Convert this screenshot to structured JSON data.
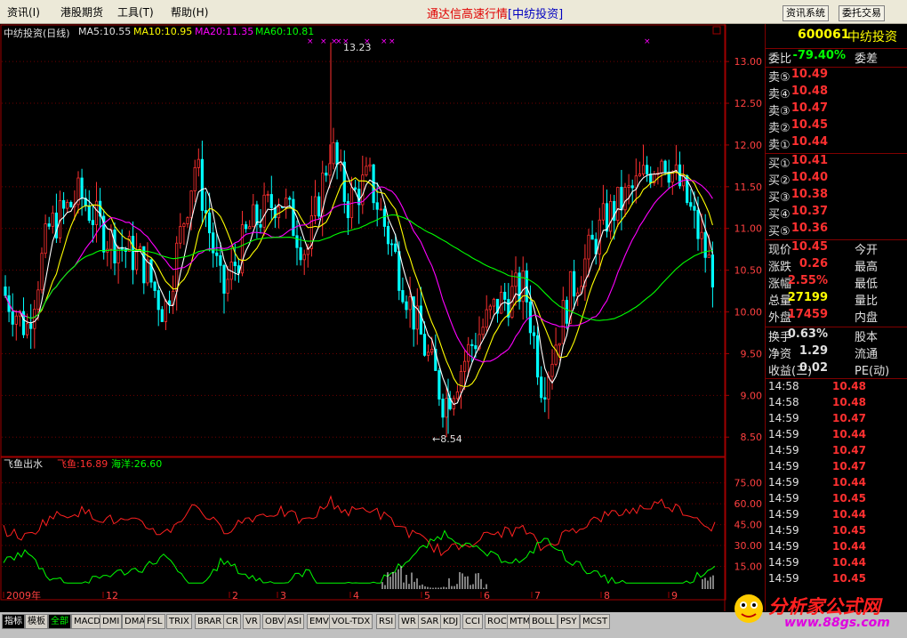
{
  "menubar": {
    "items": [
      "资讯(I)",
      "港股期货",
      "工具(T)",
      "帮助(H)"
    ],
    "title": "通达信高速行情",
    "stock_tag": "[中纺投资]",
    "btn_news": "资讯系统",
    "btn_trade": "委托交易"
  },
  "main_chart": {
    "stock_label": "中纺投资(日线)",
    "ma5": "MA5:10.55",
    "ma10": "MA10:10.95",
    "ma20": "MA20:11.35",
    "ma60": "MA60:10.81",
    "high_label": "13.23",
    "low_label": "←8.54",
    "colors": {
      "ma5": "#ffffff",
      "ma10": "#ffff00",
      "ma20": "#ff00ff",
      "ma60": "#00ff00",
      "up": "#ff3030",
      "down": "#00ffff"
    }
  },
  "indicator": {
    "name": "飞鱼出水",
    "line1": "飞鱼:16.89",
    "line2": "海洋:26.60"
  },
  "chart_data": [
    {
      "type": "candlestick",
      "title": "中纺投资(日线)",
      "ylim": [
        8.3,
        13.3
      ],
      "y_ticks": [
        "13.00",
        "12.50",
        "12.00",
        "11.50",
        "11.00",
        "10.50",
        "10.00",
        "9.50",
        "9.00",
        "8.50"
      ],
      "x_ticks": [
        "2009年",
        "12",
        "2",
        "3",
        "4",
        "5",
        "6",
        "7",
        "8",
        "9"
      ],
      "high": 13.23,
      "low": 8.54,
      "series": [
        {
          "name": "MA5",
          "last": 10.55
        },
        {
          "name": "MA10",
          "last": 10.95
        },
        {
          "name": "MA20",
          "last": 11.35
        },
        {
          "name": "MA60",
          "last": 10.81
        }
      ]
    },
    {
      "type": "line",
      "title": "飞鱼出水",
      "ylim": [
        0,
        85
      ],
      "y_ticks": [
        "75.00",
        "60.00",
        "45.00",
        "30.00",
        "15.00"
      ],
      "series": [
        {
          "name": "飞鱼",
          "last": 16.89
        },
        {
          "name": "海洋",
          "last": 26.6
        }
      ]
    }
  ],
  "panel": {
    "code": "600061",
    "name": "中纺投资",
    "wb_label": "委比",
    "wb_value": "-79.40%",
    "wc_label": "委差",
    "asks": [
      {
        "label": "卖⑤",
        "price": "10.49"
      },
      {
        "label": "卖④",
        "price": "10.48"
      },
      {
        "label": "卖③",
        "price": "10.47"
      },
      {
        "label": "卖②",
        "price": "10.45"
      },
      {
        "label": "卖①",
        "price": "10.44"
      }
    ],
    "bids": [
      {
        "label": "买①",
        "price": "10.41"
      },
      {
        "label": "买②",
        "price": "10.40"
      },
      {
        "label": "买③",
        "price": "10.38"
      },
      {
        "label": "买④",
        "price": "10.37"
      },
      {
        "label": "买⑤",
        "price": "10.36"
      }
    ],
    "stats": [
      {
        "label": "现价",
        "value": "10.45",
        "label2": "今开",
        "color": "#ff3030"
      },
      {
        "label": "涨跌",
        "value": "0.26",
        "label2": "最高",
        "color": "#ff3030"
      },
      {
        "label": "涨幅",
        "value": "2.55%",
        "label2": "最低",
        "color": "#ff3030"
      },
      {
        "label": "总量",
        "value": "27199",
        "label2": "量比",
        "color": "#ffff00"
      },
      {
        "label": "外盘",
        "value": "17459",
        "label2": "内盘",
        "color": "#ff3030"
      }
    ],
    "stats2": [
      {
        "label": "换手",
        "value": "0.63%",
        "label2": "股本",
        "color": "#e0e0e0"
      },
      {
        "label": "净资",
        "value": "1.29",
        "label2": "流通",
        "color": "#e0e0e0"
      },
      {
        "label": "收益(三)",
        "value": "0.02",
        "label2": "PE(动)",
        "color": "#e0e0e0"
      }
    ],
    "ticks": [
      {
        "time": "14:58",
        "price": "10.48"
      },
      {
        "time": "14:58",
        "price": "10.48"
      },
      {
        "time": "14:59",
        "price": "10.47"
      },
      {
        "time": "14:59",
        "price": "10.44"
      },
      {
        "time": "14:59",
        "price": "10.47"
      },
      {
        "time": "14:59",
        "price": "10.47"
      },
      {
        "time": "14:59",
        "price": "10.44"
      },
      {
        "time": "14:59",
        "price": "10.45"
      },
      {
        "time": "14:59",
        "price": "10.44"
      },
      {
        "time": "14:59",
        "price": "10.45"
      },
      {
        "time": "14:59",
        "price": "10.44"
      },
      {
        "time": "14:59",
        "price": "10.44"
      },
      {
        "time": "14:59",
        "price": "10.45"
      }
    ]
  },
  "tabs": [
    "指标",
    "模板",
    "全部",
    "MACD",
    "DMI",
    "DMA",
    "FSL",
    "TRIX",
    "BRAR",
    "CR",
    "VR",
    "OBV",
    "ASI",
    "EMV",
    "VOL-TDX",
    "RSI",
    "WR",
    "SAR",
    "KDJ",
    "CCI",
    "ROC",
    "MTM",
    "BOLL",
    "PSY",
    "MCST"
  ],
  "logo": {
    "text": "分析家公式网",
    "url": "www.88gs.com"
  }
}
